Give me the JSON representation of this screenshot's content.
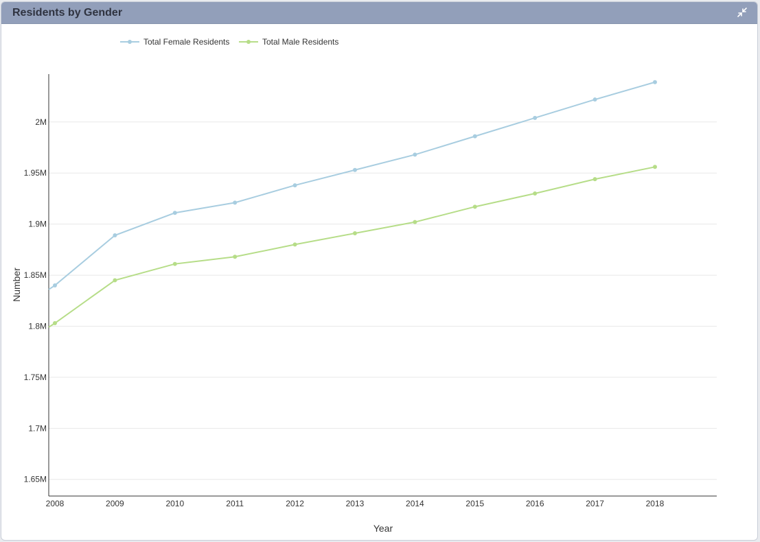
{
  "panel": {
    "title": "Residents by Gender",
    "collapse_icon": "collapse-arrows-icon"
  },
  "colors": {
    "header": "#929fba",
    "female": "#a8cde0",
    "male": "#b6dd88",
    "axis": "#333333",
    "grid": "#e8e8e8"
  },
  "chart_data": {
    "type": "line",
    "xlabel": "Year",
    "ylabel": "Number",
    "x": [
      2008,
      2009,
      2010,
      2011,
      2012,
      2013,
      2014,
      2015,
      2016,
      2017,
      2018
    ],
    "xlim": [
      2008,
      2019.03
    ],
    "ylim": [
      1.6337,
      2.0469
    ],
    "y_ticks": [
      1.65,
      1.7,
      1.75,
      1.8,
      1.85,
      1.9,
      1.95,
      2.0
    ],
    "y_tick_labels": [
      "1.65M",
      "1.7M",
      "1.75M",
      "1.8M",
      "1.85M",
      "1.9M",
      "1.95M",
      "2M"
    ],
    "y_unit": "M",
    "grid": true,
    "legend": "top-left",
    "series": [
      {
        "name": "Total Female Residents",
        "color": "#a8cde0",
        "values": [
          1.84,
          1.889,
          1.911,
          1.921,
          1.938,
          1.953,
          1.968,
          1.986,
          2.004,
          2.022,
          2.039
        ],
        "leading_value": 1.836
      },
      {
        "name": "Total Male Residents",
        "color": "#b6dd88",
        "values": [
          1.803,
          1.845,
          1.861,
          1.868,
          1.88,
          1.891,
          1.902,
          1.917,
          1.93,
          1.944,
          1.956
        ],
        "leading_value": 1.799
      }
    ]
  }
}
